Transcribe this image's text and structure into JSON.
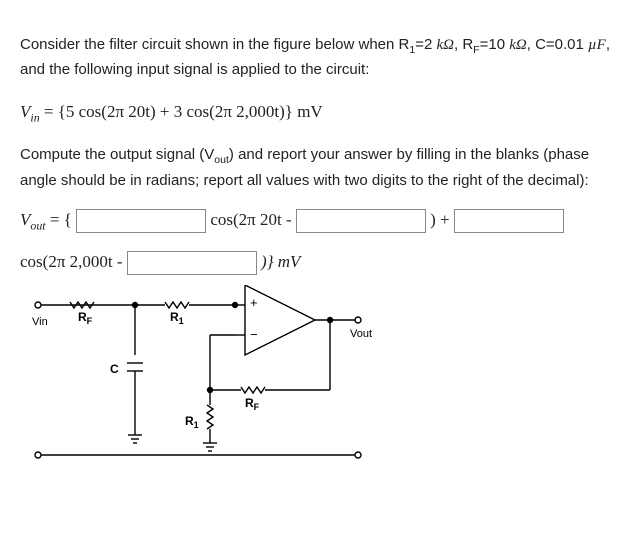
{
  "p1_a": "Consider the filter circuit shown in the figure below when R",
  "p1_b": "=2 ",
  "p1_c": ", R",
  "p1_d": "=10 ",
  "p1_e": ", C=0.01 ",
  "p1_f": ", and the following input signal is applied to the circuit:",
  "sub1": "1",
  "subF": "F",
  "kohm": "kΩ",
  "uF": "µF",
  "vin_lhs": "V",
  "vin_sub": "in",
  "vin_rhs": " = {5 cos(2π 20t) + 3 cos(2π 2,000t)} mV",
  "p2_a": "Compute the output signal (V",
  "p2_sub": "out",
  "p2_b": ") and report your answer by filling in the blanks (phase angle should be in radians; report all values with two digits to the right of the decimal):",
  "vout_lhs": "V",
  "vout_sub": "out",
  "vout_eq": " = { ",
  "f1_after": " cos(2π 20t - ",
  "f2_after": " ) + ",
  "line2_pre": "cos(2π 2,000t - ",
  "line2_post": " )} mV",
  "svg": {
    "Vin": "Vin",
    "RF": "R",
    "RFs": "F",
    "R1": "R",
    "R1s": "1",
    "C": "C",
    "Vout": "Vout",
    "plus": "+",
    "minus": "−"
  }
}
